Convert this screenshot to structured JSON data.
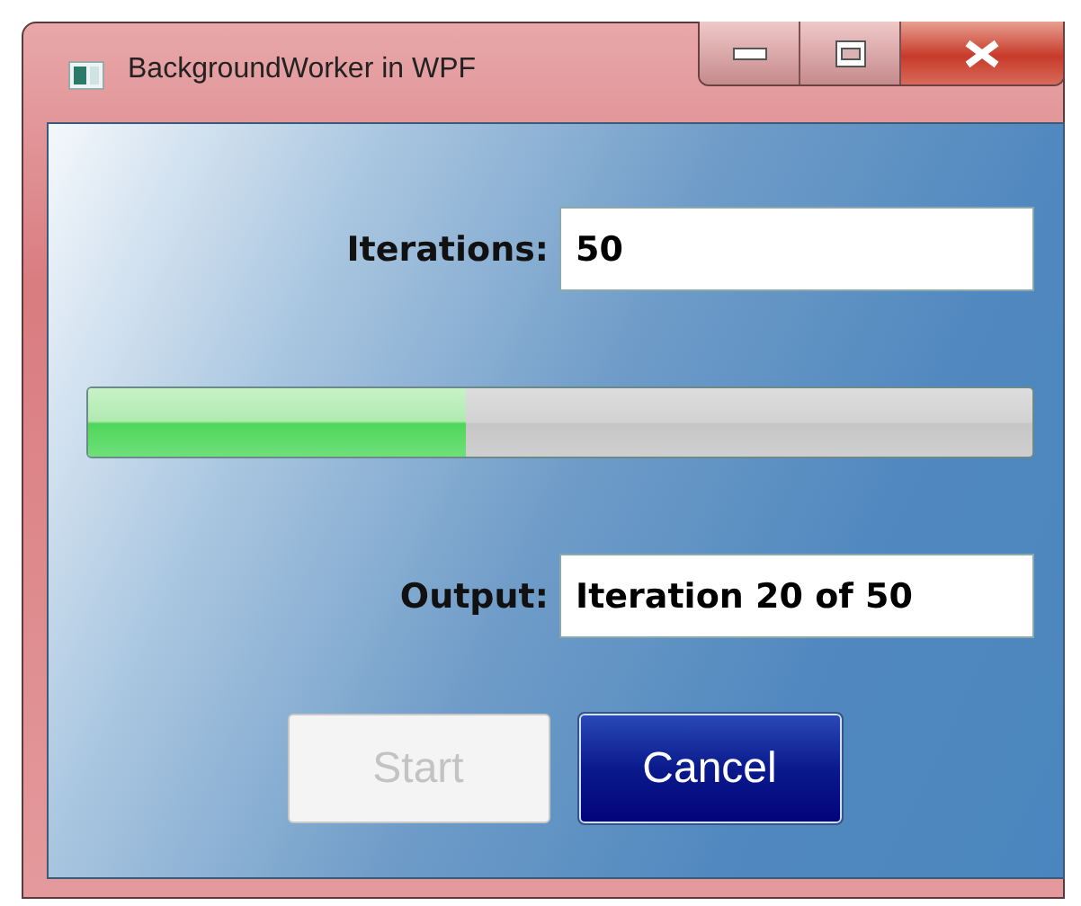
{
  "window": {
    "title": "BackgroundWorker in WPF"
  },
  "iterations": {
    "label": "Iterations:",
    "value": "50"
  },
  "progress": {
    "level": 0.4
  },
  "output": {
    "label": "Output:",
    "value": "Iteration 20 of 50"
  },
  "buttons": [
    {
      "label": "Start",
      "disabled": true,
      "kind": "start"
    },
    {
      "label": "Cancel",
      "disabled": false,
      "kind": "cancel"
    }
  ]
}
